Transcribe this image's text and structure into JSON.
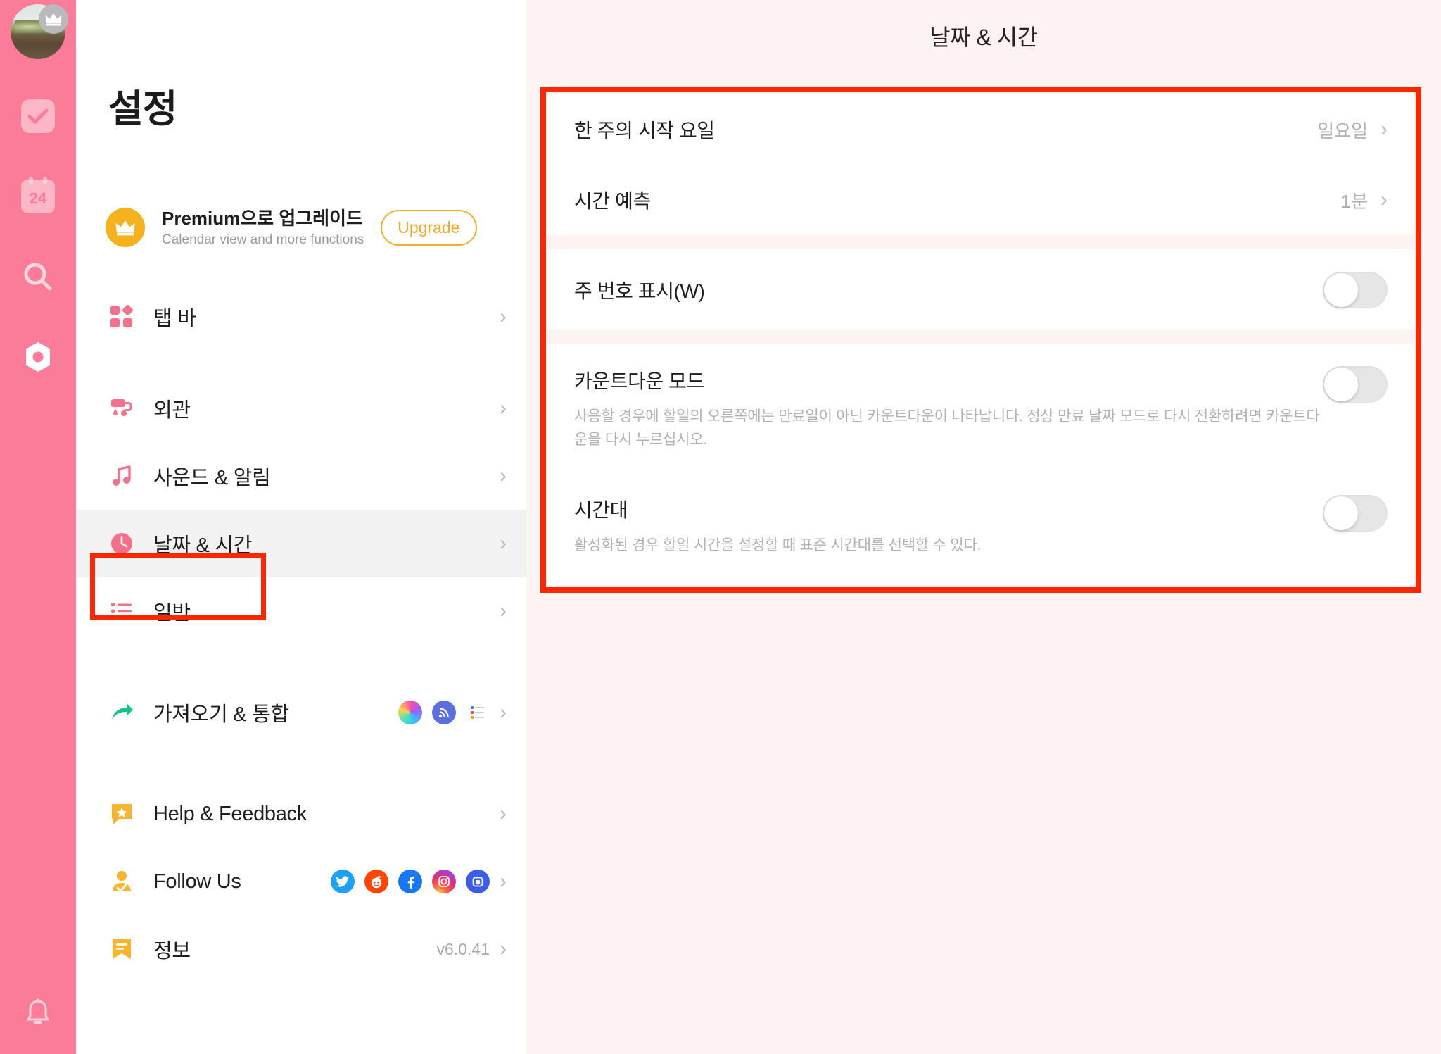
{
  "rail": {
    "avatar": {
      "name": "user-avatar",
      "badge_icon": "crown-icon"
    },
    "items": [
      {
        "icon": "check-task-icon",
        "name": "tasks"
      },
      {
        "icon": "calendar-24-icon",
        "name": "calendar",
        "label": "24"
      },
      {
        "icon": "search-icon",
        "name": "search"
      },
      {
        "icon": "settings-gear-icon",
        "name": "settings"
      }
    ],
    "bottom": {
      "icon": "bell-icon",
      "name": "notifications"
    }
  },
  "sidebar": {
    "title": "설정",
    "premium": {
      "icon": "crown-icon",
      "title": "Premium으로 업그레이드",
      "subtitle": "Calendar view and more functions",
      "button": "Upgrade"
    },
    "items": [
      {
        "label": "탭 바",
        "icon": "tab-bar-icon",
        "chevron": "›"
      },
      {
        "label": "외관",
        "icon": "appearance-paint-roller-icon",
        "chevron": "›"
      },
      {
        "label": "사운드 & 알림",
        "icon": "sound-note-icon",
        "chevron": "›"
      },
      {
        "label": "날짜 & 시간",
        "icon": "clock-icon",
        "chevron": "›",
        "active": true
      },
      {
        "label": "일반",
        "icon": "general-list-icon",
        "chevron": "›"
      },
      {
        "label": "가져오기 & 통합",
        "icon": "import-share-arrow-icon",
        "chevron": "›"
      },
      {
        "label": "Help & Feedback",
        "icon": "help-star-flag-icon",
        "chevron": "›"
      },
      {
        "label": "Follow Us",
        "icon": "follow-user-check-icon",
        "chevron": "›"
      },
      {
        "label": "정보",
        "icon": "info-bookmark-icon",
        "chevron": "›",
        "value": "v6.0.41"
      }
    ],
    "integration_icons": [
      "siri-icon",
      "rss-icon",
      "list-app-icon"
    ],
    "social_icons": [
      "twitter-icon",
      "reddit-icon",
      "facebook-icon",
      "instagram-icon",
      "bilibili-icon"
    ]
  },
  "main": {
    "title": "날짜 & 시간",
    "rows": [
      {
        "type": "value",
        "label": "한 주의 시작 요일",
        "value": "일요일",
        "chevron": "›"
      },
      {
        "type": "value",
        "label": "시간 예측",
        "value": "1분",
        "chevron": "›"
      },
      {
        "type": "toggle",
        "label": "주 번호 표시(W)",
        "desc": "",
        "on": false
      },
      {
        "type": "toggle",
        "label": "카운트다운 모드",
        "desc": "사용할 경우에 할일의 오른쪽에는 만료일이 아닌 카운트다운이 나타납니다. 정상 만료 날짜 모드로 다시 전환하려면 카운트다운을 다시 누르십시오.",
        "on": false
      },
      {
        "type": "toggle",
        "label": "시간대",
        "desc": "활성화된 경우 할일 시간을 설정할 때 표준 시간대를 선택할 수 있다.",
        "on": false
      }
    ]
  },
  "colors": {
    "rail_pink": "#fa7c98",
    "page_bg": "#fdf3f3",
    "accent_pink": "#f4718c",
    "highlight_red": "#f92800",
    "gold": "#f5b21e",
    "toggle_off": "#e6e6e6"
  }
}
